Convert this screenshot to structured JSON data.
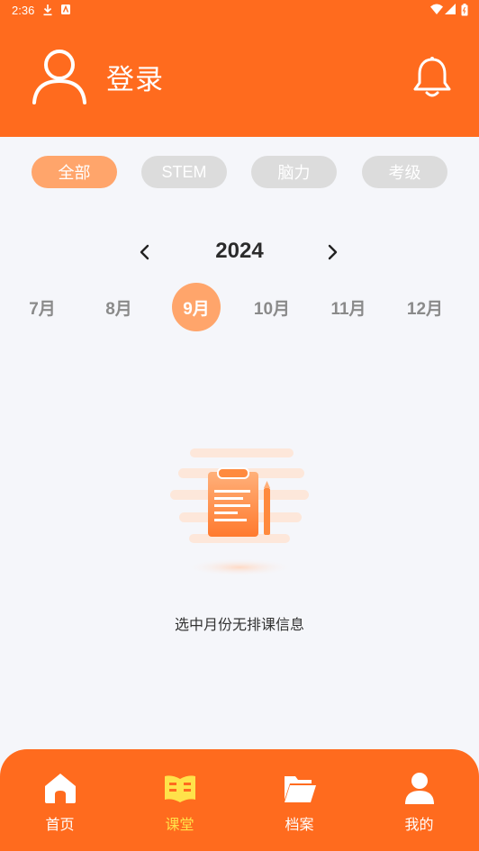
{
  "status_bar": {
    "time": "2:36"
  },
  "header": {
    "title": "登录"
  },
  "filters": [
    {
      "label": "全部",
      "active": true
    },
    {
      "label": "STEM",
      "active": false
    },
    {
      "label": "脑力",
      "active": false
    },
    {
      "label": "考级",
      "active": false
    }
  ],
  "calendar": {
    "year": "2024",
    "months": [
      {
        "label": "7月",
        "active": false
      },
      {
        "label": "8月",
        "active": false
      },
      {
        "label": "9月",
        "active": true
      },
      {
        "label": "10月",
        "active": false
      },
      {
        "label": "11月",
        "active": false
      },
      {
        "label": "12月",
        "active": false
      }
    ]
  },
  "empty_state": {
    "message": "选中月份无排课信息"
  },
  "tabbar": {
    "items": [
      {
        "label": "首页",
        "icon": "home-icon",
        "active": false
      },
      {
        "label": "课堂",
        "icon": "book-icon",
        "active": true
      },
      {
        "label": "档案",
        "icon": "folder-icon",
        "active": false
      },
      {
        "label": "我的",
        "icon": "user-icon",
        "active": false
      }
    ]
  },
  "colors": {
    "primary": "#FF6B1E",
    "accent_light": "#FFA56B",
    "chip_inactive": "#DCDCDC",
    "tab_active": "#FFE24A",
    "background": "#F5F6FA"
  }
}
